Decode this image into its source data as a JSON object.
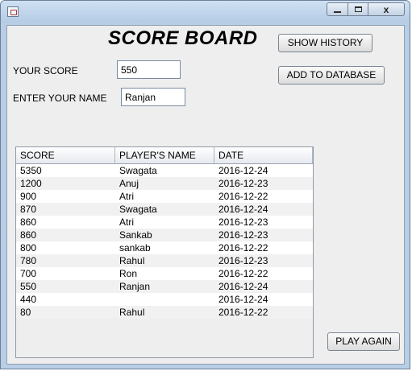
{
  "window": {
    "icon": "app-window-icon",
    "controls": {
      "minimize": "minimize-icon",
      "maximize": "maximize-icon",
      "close": "close-icon"
    },
    "close_glyph": "x"
  },
  "board": {
    "title": "SCORE BOARD",
    "your_score_label": "YOUR SCORE",
    "your_score_value": "550",
    "name_label": "ENTER YOUR NAME",
    "name_value": "Ranjan"
  },
  "buttons": {
    "show_history": "SHOW HISTORY",
    "add_to_database": "ADD TO DATABASE",
    "play_again": "PLAY AGAIN"
  },
  "table": {
    "columns": [
      "SCORE",
      "PLAYER'S NAME",
      "DATE"
    ],
    "rows": [
      [
        "5350",
        "Swagata",
        "2016-12-24"
      ],
      [
        "1200",
        "Anuj",
        "2016-12-23"
      ],
      [
        "900",
        "Atri",
        "2016-12-22"
      ],
      [
        "870",
        "Swagata",
        "2016-12-24"
      ],
      [
        "860",
        "Atri",
        "2016-12-23"
      ],
      [
        "860",
        "Sankab",
        "2016-12-23"
      ],
      [
        "800",
        "sankab",
        "2016-12-22"
      ],
      [
        "780",
        "Rahul",
        "2016-12-23"
      ],
      [
        "700",
        "Ron",
        "2016-12-22"
      ],
      [
        "550",
        "Ranjan",
        "2016-12-24"
      ],
      [
        "440",
        "",
        "2016-12-24"
      ],
      [
        "80",
        "Rahul",
        "2016-12-22"
      ]
    ]
  }
}
